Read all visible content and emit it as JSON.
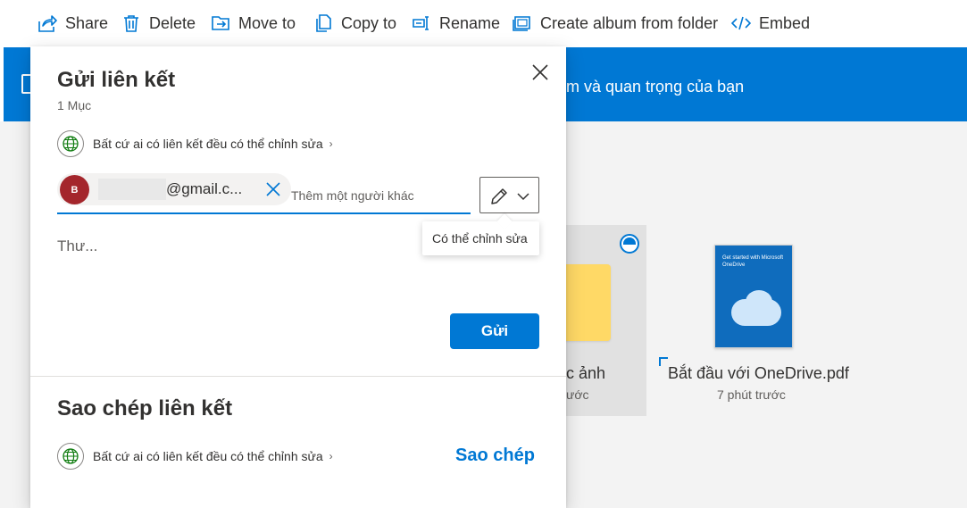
{
  "command_bar": {
    "share": "Share",
    "delete": "Delete",
    "move_to": "Move to",
    "copy_to": "Copy to",
    "rename": "Rename",
    "create_album": "Create album from folder",
    "embed": "Embed"
  },
  "banner": {
    "text": "m và quan trọng của bạn"
  },
  "files": {
    "folder_name_partial": "c ảnh",
    "folder_date_partial": "ước",
    "pdf_name": "Bắt đầu với OneDrive.pdf",
    "pdf_date": "7 phút trước",
    "pdf_thumb_title": "Get started with Microsoft OneDrive"
  },
  "share_panel": {
    "title": "Gửi liên kết",
    "item_count": "1 Mục",
    "permission_text": "Bất cứ ai có liên kết đều có thể chỉnh sửa",
    "recipient": {
      "avatar_initial": "B",
      "email_suffix": "@gmail.c..."
    },
    "add_placeholder": "Thêm một người khác",
    "tooltip": "Có thể chỉnh sửa",
    "message_placeholder": "Thư...",
    "send_label": "Gửi",
    "copy_section_title": "Sao chép liên kết",
    "copy_permission_text": "Bất cứ ai có liên kết đều có thể chỉnh sửa",
    "copy_label": "Sao chép"
  },
  "colors": {
    "accent": "#0078d4",
    "avatar": "#a4262c",
    "folder": "#ffd966"
  }
}
